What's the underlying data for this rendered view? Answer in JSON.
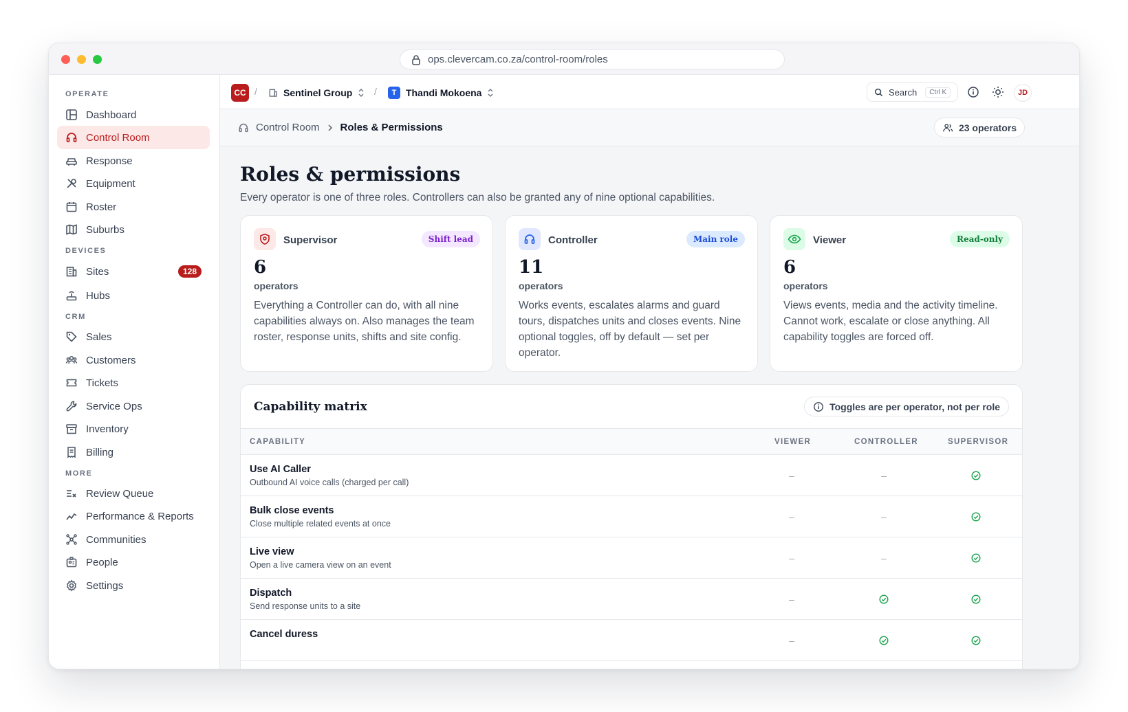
{
  "browser": {
    "url": "ops.clevercam.co.za/control-room/roles"
  },
  "sidebar": {
    "sections": [
      {
        "label": "OPERATE"
      },
      {
        "label": "DEVICES"
      },
      {
        "label": "CRM"
      },
      {
        "label": "MORE"
      }
    ],
    "items": [
      {
        "label": "Dashboard",
        "icon": "layout-icon"
      },
      {
        "label": "Control Room",
        "icon": "headset-icon",
        "active": true
      },
      {
        "label": "Response",
        "icon": "car-icon"
      },
      {
        "label": "Equipment",
        "icon": "tools-icon"
      },
      {
        "label": "Roster",
        "icon": "calendar-icon"
      },
      {
        "label": "Suburbs",
        "icon": "map-icon"
      },
      {
        "label": "Sites",
        "icon": "building-icon",
        "badge": "128"
      },
      {
        "label": "Hubs",
        "icon": "hub-icon"
      },
      {
        "label": "Sales",
        "icon": "tag-icon"
      },
      {
        "label": "Customers",
        "icon": "users-icon"
      },
      {
        "label": "Tickets",
        "icon": "ticket-icon"
      },
      {
        "label": "Service Ops",
        "icon": "wrench-icon"
      },
      {
        "label": "Inventory",
        "icon": "archive-icon"
      },
      {
        "label": "Billing",
        "icon": "receipt-icon"
      },
      {
        "label": "Review Queue",
        "icon": "list-check-icon"
      },
      {
        "label": "Performance & Reports",
        "icon": "trend-icon"
      },
      {
        "label": "Communities",
        "icon": "network-icon"
      },
      {
        "label": "People",
        "icon": "badge-icon"
      },
      {
        "label": "Settings",
        "icon": "gear-icon"
      }
    ]
  },
  "topbar": {
    "logo": "CC",
    "org": "Sentinel Group",
    "user": "Thandi Mokoena",
    "user_initial": "T",
    "search_label": "Search",
    "search_kbd": "Ctrl K",
    "avatar": "JD"
  },
  "subbar": {
    "breadcrumb_parent": "Control Room",
    "breadcrumb_current": "Roles & Permissions",
    "operators_pill": "23 operators"
  },
  "page": {
    "title": "Roles & permissions",
    "subtitle": "Every operator is one of three roles. Controllers can also be granted any of nine optional capabilities."
  },
  "roles": [
    {
      "name": "Supervisor",
      "tag": "Shift lead",
      "count": "6",
      "unit": "operators",
      "desc": "Everything a Controller can do, with all nine capabilities always on. Also manages the team roster, response units, shifts and site config."
    },
    {
      "name": "Controller",
      "tag": "Main role",
      "count": "11",
      "unit": "operators",
      "desc": "Works events, escalates alarms and guard tours, dispatches units and closes events. Nine optional toggles, off by default — set per operator."
    },
    {
      "name": "Viewer",
      "tag": "Read-only",
      "count": "6",
      "unit": "operators",
      "desc": "Views events, media and the activity timeline. Cannot work, escalate or close anything. All capability toggles are forced off."
    }
  ],
  "colors": {
    "accent": "#b91c1c",
    "supervisor_bg": "#fde8e8",
    "controller_bg": "#e0e7ff",
    "viewer_bg": "#dcfce7",
    "check": "#16a34a"
  },
  "matrix": {
    "title": "Capability matrix",
    "note": "Toggles are per operator, not per role",
    "columns": [
      "CAPABILITY",
      "VIEWER",
      "CONTROLLER",
      "SUPERVISOR"
    ],
    "dash": "–",
    "rows": [
      {
        "title": "Use AI Caller",
        "sub": "Outbound AI voice calls (charged per call)",
        "viewer": false,
        "controller": false,
        "supervisor": true
      },
      {
        "title": "Bulk close events",
        "sub": "Close multiple related events at once",
        "viewer": false,
        "controller": false,
        "supervisor": true
      },
      {
        "title": "Live view",
        "sub": "Open a live camera view on an event",
        "viewer": false,
        "controller": false,
        "supervisor": true
      },
      {
        "title": "Dispatch",
        "sub": "Send response units to a site",
        "viewer": false,
        "controller": true,
        "supervisor": true
      },
      {
        "title": "Cancel duress",
        "sub": "",
        "viewer": false,
        "controller": true,
        "supervisor": true
      }
    ]
  }
}
